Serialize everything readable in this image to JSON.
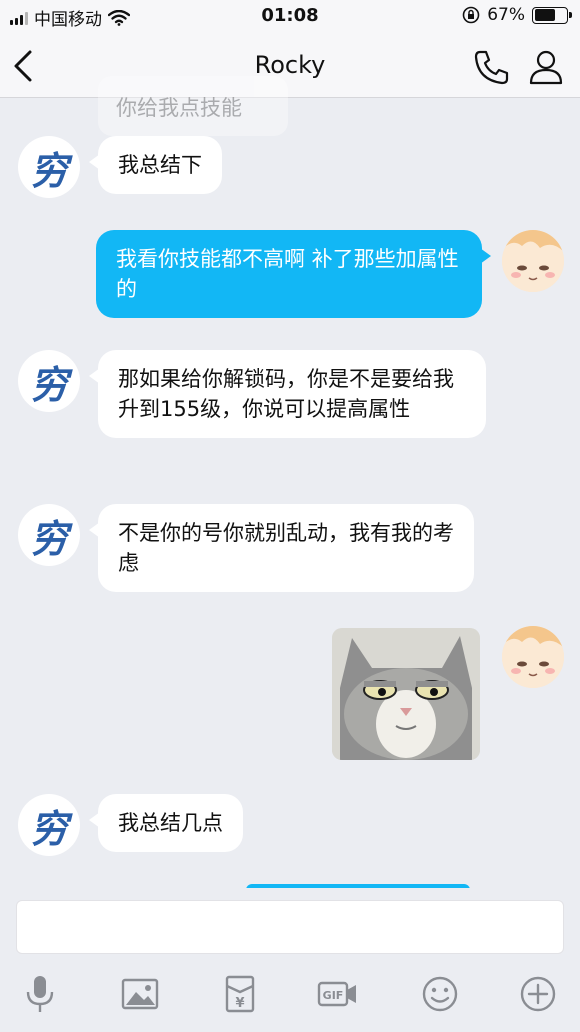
{
  "status_bar": {
    "carrier": "中国移动",
    "time": "01:08",
    "battery_percent": "67%",
    "battery_level": 0.67
  },
  "nav": {
    "title": "Rocky",
    "icons": [
      "back-chevron-icon",
      "phone-icon",
      "user-icon"
    ]
  },
  "messages": {
    "ghost": "你给我点技能",
    "m1": "我总结下",
    "m2": "我看你技能都不高啊 补了那些加属性的",
    "m3": "那如果给你解锁码，你是不是要给我升到155级，你说可以提高属性",
    "m4": "不是你的号你就别乱动，我有我的考虑",
    "m5": "我总结几点"
  },
  "avatars": {
    "left_glyph": "穷"
  },
  "input": {
    "placeholder": ""
  },
  "toolbar": {
    "icons": [
      "microphone-icon",
      "image-icon",
      "red-packet-icon",
      "gif-icon",
      "emoji-icon",
      "plus-icon"
    ]
  },
  "colors": {
    "out_bubble": "#12b7f5",
    "in_bubble": "#ffffff",
    "background": "#ebedf2"
  }
}
